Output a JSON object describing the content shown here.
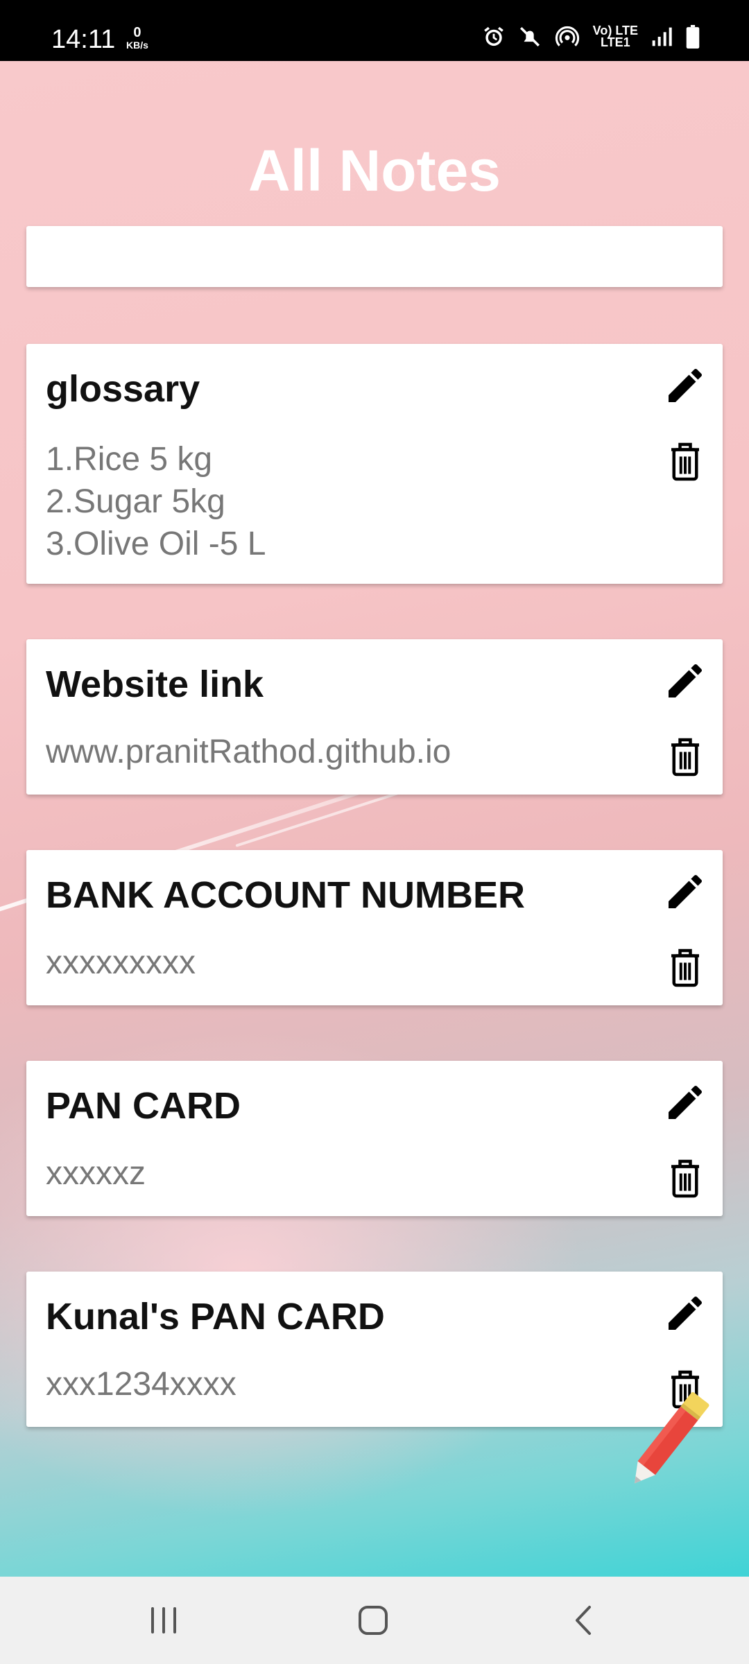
{
  "status_bar": {
    "time": "14:11",
    "speed_value": "0",
    "speed_unit": "KB/s",
    "network_top": "Vo) LTE",
    "network_bottom": "LTE1",
    "icons": [
      "alarm-icon",
      "mute-icon",
      "hotspot-icon",
      "signal-icon",
      "battery-icon"
    ]
  },
  "app": {
    "title": "All Notes",
    "notes": [
      {
        "title": "",
        "body": ""
      },
      {
        "title": "glossary",
        "body": "1.Rice 5 kg\n2.Sugar 5kg\n3.Olive Oil -5 L"
      },
      {
        "title": "Website link",
        "body": "www.pranitRathod.github.io"
      },
      {
        "title": "BANK ACCOUNT NUMBER",
        "body": "xxxxxxxxx"
      },
      {
        "title": "PAN CARD",
        "body": "xxxxxz"
      },
      {
        "title": "Kunal's PAN CARD",
        "body": "xxx1234xxxx"
      }
    ],
    "icons": {
      "edit": "pencil-icon",
      "delete": "trash-icon",
      "fab": "add-note-pencil-icon"
    }
  },
  "nav_bar": {
    "buttons": [
      "recent-apps-icon",
      "home-icon",
      "back-icon"
    ]
  },
  "colors": {
    "title_text": "#ffffff",
    "card_bg": "#ffffff",
    "note_title": "#111111",
    "note_body": "#777777",
    "fab_body": "#e8453c",
    "fab_tip": "#f2d45c"
  }
}
